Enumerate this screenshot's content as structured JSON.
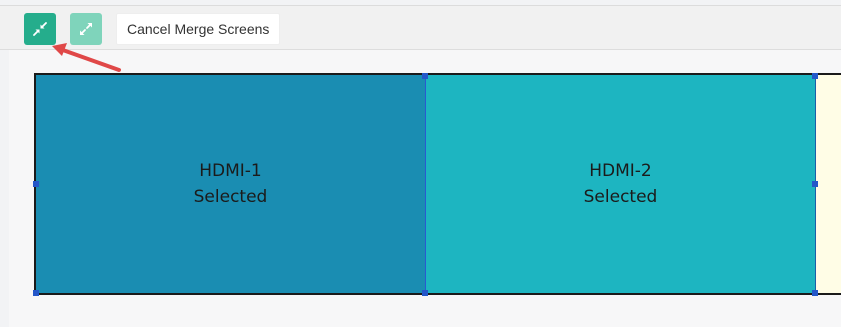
{
  "toolbar": {
    "compress_button": {
      "icon": "compress-arrows-icon",
      "color": "#25ad8c"
    },
    "expand_button": {
      "icon": "expand-arrows-icon",
      "color": "#7fd4bb"
    },
    "cancel_label": "Cancel Merge Screens"
  },
  "annotation": {
    "icon": "red-pointer-arrow",
    "color": "#e04848"
  },
  "screens": [
    {
      "name": "HDMI-1",
      "status": "Selected",
      "color": "#1a8db2"
    },
    {
      "name": "HDMI-2",
      "status": "Selected",
      "color": "#1db5c1"
    },
    {
      "name": "",
      "status": "",
      "color": "#fffde6"
    }
  ]
}
